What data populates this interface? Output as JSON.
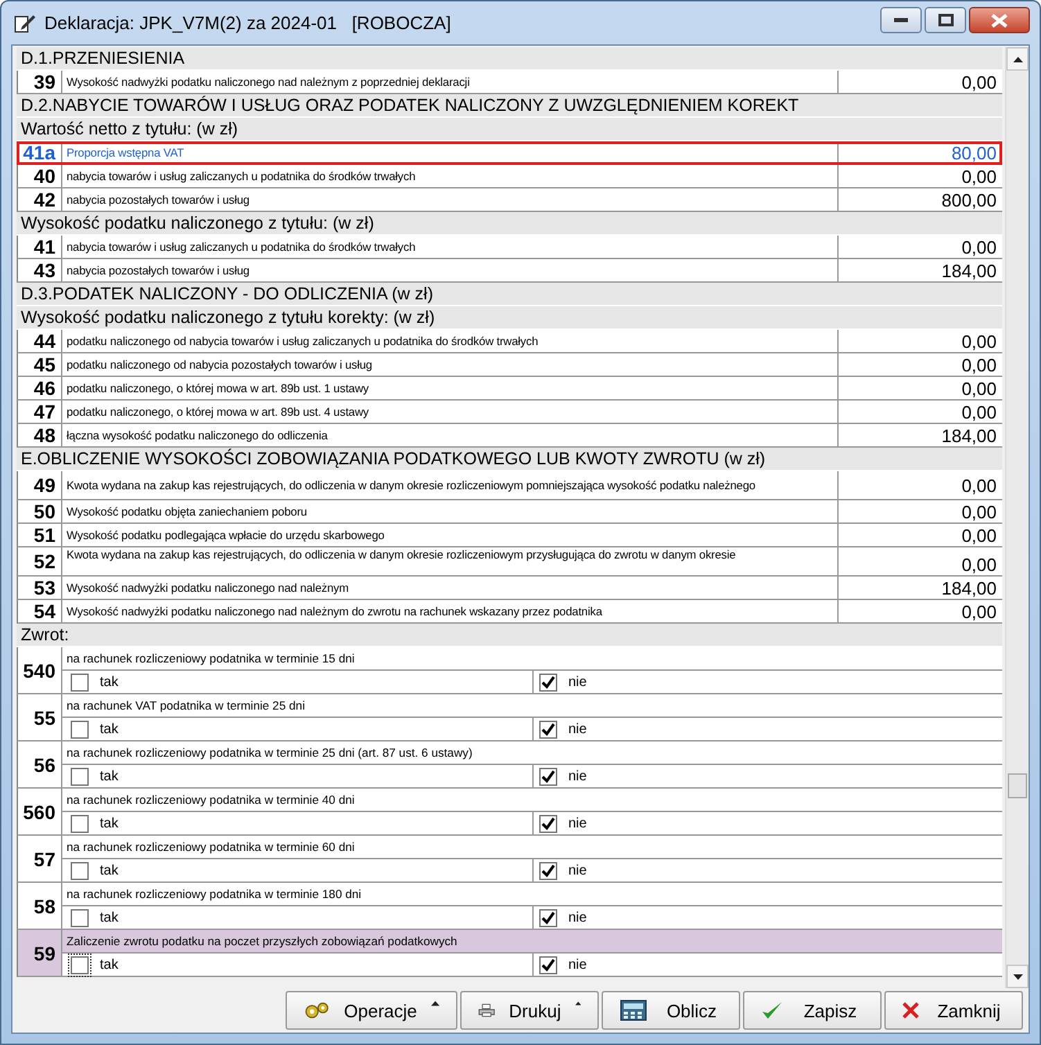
{
  "window": {
    "title": "Deklaracja: JPK_V7M(2) za 2024-01   [ROBOCZA]"
  },
  "rows": [
    {
      "kind": "section",
      "label": "D.1.PRZENIESIENIA"
    },
    {
      "kind": "amount",
      "number": "39",
      "label": "Wysokość nadwyżki podatku naliczonego nad należnym z poprzedniej deklaracji",
      "value": "0,00",
      "selected": false
    },
    {
      "kind": "section",
      "label": "D.2.NABYCIE TOWARÓW I USŁUG ORAZ PODATEK NALICZONY Z UWZGLĘDNIENIEM KOREKT"
    },
    {
      "kind": "section",
      "label": "Wartość netto z tytułu: (w zł)"
    },
    {
      "kind": "amount",
      "number": "41a",
      "label": "Proporcja wstępna VAT",
      "value": "80,00",
      "selected": true
    },
    {
      "kind": "amount",
      "number": "40",
      "label": "nabycia towarów i usług zaliczanych u podatnika do środków trwałych",
      "value": "0,00",
      "selected": false
    },
    {
      "kind": "amount",
      "number": "42",
      "label": "nabycia pozostałych towarów i usług",
      "value": "800,00",
      "selected": false
    },
    {
      "kind": "section",
      "label": "Wysokość podatku naliczonego z tytułu: (w zł)"
    },
    {
      "kind": "amount",
      "number": "41",
      "label": "nabycia towarów i usług zaliczanych u podatnika do środków trwałych",
      "value": "0,00",
      "selected": false
    },
    {
      "kind": "amount",
      "number": "43",
      "label": "nabycia pozostałych towarów i usług",
      "value": "184,00",
      "selected": false
    },
    {
      "kind": "section",
      "label": "D.3.PODATEK NALICZONY - DO ODLICZENIA (w zł)"
    },
    {
      "kind": "section",
      "label": "Wysokość podatku naliczonego z tytułu korekty: (w zł)"
    },
    {
      "kind": "amount",
      "number": "44",
      "label": "podatku naliczonego od nabycia towarów i usług zaliczanych u podatnika do środków trwałych",
      "value": "0,00",
      "selected": false
    },
    {
      "kind": "amount",
      "number": "45",
      "label": "podatku naliczonego od nabycia pozostałych towarów i usług",
      "value": "0,00",
      "selected": false
    },
    {
      "kind": "amount",
      "number": "46",
      "label": "podatku naliczonego, o której mowa w art. 89b ust. 1 ustawy",
      "value": "0,00",
      "selected": false
    },
    {
      "kind": "amount",
      "number": "47",
      "label": "podatku naliczonego, o której mowa w art. 89b ust. 4 ustawy",
      "value": "0,00",
      "selected": false
    },
    {
      "kind": "amount",
      "number": "48",
      "label": "łączna wysokość podatku naliczonego do odliczenia",
      "value": "184,00",
      "selected": false
    },
    {
      "kind": "section",
      "label": "E.OBLICZENIE WYSOKOŚCI ZOBOWIĄZANIA PODATKOWEGO LUB KWOTY ZWROTU (w zł)"
    },
    {
      "kind": "tall",
      "number": "49",
      "label": "Kwota wydana na zakup kas rejestrujących, do odliczenia w danym okresie rozliczeniowym pomniejszająca wysokość podatku należnego",
      "value": "0,00",
      "selected": false
    },
    {
      "kind": "amount",
      "number": "50",
      "label": "Wysokość podatku objęta zaniechaniem poboru",
      "value": "0,00",
      "selected": false
    },
    {
      "kind": "amount",
      "number": "51",
      "label": "Wysokość podatku podlegająca wpłacie do urzędu skarbowego",
      "value": "0,00",
      "selected": false
    },
    {
      "kind": "tall",
      "number": "52",
      "label": "Kwota wydana na zakup kas rejestrujących, do odliczenia w danym okresie rozliczeniowym przysługująca do zwrotu w danym okresie",
      "value": "0,00",
      "selected": false
    },
    {
      "kind": "amount",
      "number": "53",
      "label": "Wysokość nadwyżki podatku naliczonego nad należnym",
      "value": "184,00",
      "selected": false
    },
    {
      "kind": "amount",
      "number": "54",
      "label": "Wysokość nadwyżki podatku naliczonego nad należnym do zwrotu na rachunek wskazany przez podatnika",
      "value": "0,00",
      "selected": false
    },
    {
      "kind": "section",
      "label": "Zwrot:"
    },
    {
      "kind": "choice",
      "number": "540",
      "label": "na rachunek rozliczeniowy podatnika w terminie 15 dni",
      "yes": "tak",
      "yes_checked": false,
      "no": "nie",
      "no_checked": true,
      "selected": false
    },
    {
      "kind": "choice",
      "number": "55",
      "label": "na rachunek VAT podatnika w terminie 25 dni",
      "yes": "tak",
      "yes_checked": false,
      "no": "nie",
      "no_checked": true,
      "selected": false
    },
    {
      "kind": "choice",
      "number": "56",
      "label": "na rachunek rozliczeniowy podatnika w terminie 25 dni (art. 87 ust. 6 ustawy)",
      "yes": "tak",
      "yes_checked": false,
      "no": "nie",
      "no_checked": true,
      "selected": false
    },
    {
      "kind": "choice",
      "number": "560",
      "label": "na rachunek rozliczeniowy podatnika w terminie 40 dni",
      "yes": "tak",
      "yes_checked": false,
      "no": "nie",
      "no_checked": true,
      "selected": false
    },
    {
      "kind": "choice",
      "number": "57",
      "label": "na rachunek rozliczeniowy podatnika w terminie 60 dni",
      "yes": "tak",
      "yes_checked": false,
      "no": "nie",
      "no_checked": true,
      "selected": false
    },
    {
      "kind": "choice",
      "number": "58",
      "label": "na rachunek rozliczeniowy podatnika w terminie 180 dni",
      "yes": "tak",
      "yes_checked": false,
      "no": "nie",
      "no_checked": true,
      "selected": false
    },
    {
      "kind": "choice",
      "number": "59",
      "label": "Zaliczenie zwrotu podatku na poczet przyszłych zobowiązań podatkowych",
      "yes": "tak",
      "yes_checked": false,
      "no": "nie",
      "no_checked": true,
      "selected": true
    }
  ],
  "buttons": [
    {
      "kind": "operations",
      "label": "Operacje",
      "menu": true
    },
    {
      "kind": "print",
      "label": "Drukuj",
      "menu": true
    },
    {
      "kind": "calculate",
      "label": "Oblicz",
      "menu": false
    },
    {
      "kind": "save",
      "label": "Zapisz",
      "menu": false
    },
    {
      "kind": "close",
      "label": "Zamknij",
      "menu": false
    }
  ]
}
